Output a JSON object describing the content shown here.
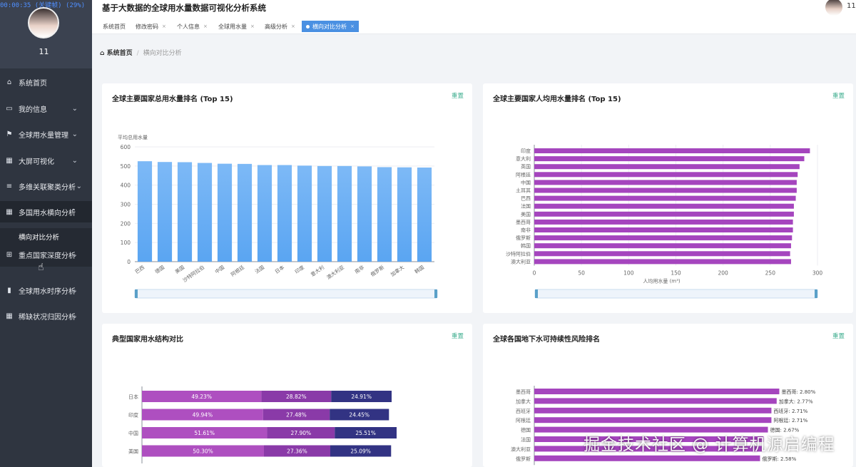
{
  "recording": "00:00:35 (关键帧) (29%)",
  "user": {
    "name": "11"
  },
  "app": {
    "title": "基于大数据的全球用水量数据可视化分析系统"
  },
  "sidebar": {
    "items": [
      {
        "label": "系统首页",
        "icon": "home-icon"
      },
      {
        "label": "我的信息",
        "icon": "card-icon"
      },
      {
        "label": "全球用水量管理",
        "icon": "flag-icon"
      },
      {
        "label": "大屏可视化",
        "icon": "grid-icon"
      },
      {
        "label": "多维关联聚类分析",
        "icon": "list-icon"
      },
      {
        "label": "多国用水横向分析",
        "icon": "grid-icon"
      },
      {
        "label": "重点国家深度分析",
        "icon": "apps-icon"
      },
      {
        "label": "全球用水时序分析",
        "icon": "bar-chart-icon"
      },
      {
        "label": "稀缺状况归因分析",
        "icon": "grid-icon"
      }
    ],
    "subitem": "横向对比分析"
  },
  "tabs": [
    {
      "label": "系统首页"
    },
    {
      "label": "修改密码"
    },
    {
      "label": "个人信息"
    },
    {
      "label": "全球用水量"
    },
    {
      "label": "高级分析"
    },
    {
      "label": "横向对比分析"
    }
  ],
  "breadcrumb": {
    "home": "系统首页",
    "sep": "/",
    "current": "横向对比分析"
  },
  "reset_label": "重置",
  "cards": {
    "c1": {
      "title": "全球主要国家总用水量排名 (Top 15)"
    },
    "c2": {
      "title": "全球主要国家人均用水量排名 (Top 15)"
    },
    "c3": {
      "title": "典型国家用水结构对比"
    },
    "c4": {
      "title": "全球各国地下水可持续性风险排名"
    }
  },
  "chart_data": [
    {
      "type": "bar",
      "title": "全球主要国家总用水量排名 (Top 15)",
      "ylabel": "平均总用水量",
      "categories": [
        "巴西",
        "德国",
        "美国",
        "沙特阿拉伯",
        "中国",
        "阿根廷",
        "法国",
        "日本",
        "印度",
        "意大利",
        "澳大利亚",
        "南非",
        "俄罗斯",
        "加拿大",
        "韩国"
      ],
      "values": [
        525,
        521,
        520,
        516,
        512,
        511,
        505,
        505,
        502,
        500,
        500,
        498,
        494,
        493,
        492
      ],
      "ylim": [
        0,
        600
      ],
      "yticks": [
        "0",
        "100",
        "200",
        "300",
        "400",
        "500",
        "600"
      ],
      "color": "#5aa5f2"
    },
    {
      "type": "bar",
      "orientation": "horizontal",
      "title": "全球主要国家人均用水量排名 (Top 15)",
      "xlabel": "人均用水量 (m³)",
      "categories": [
        "印度",
        "意大利",
        "英国",
        "阿根廷",
        "中国",
        "土耳其",
        "巴西",
        "法国",
        "美国",
        "墨西哥",
        "南非",
        "俄罗斯",
        "韩国",
        "沙特阿拉伯",
        "澳大利亚"
      ],
      "values": [
        292,
        286,
        281,
        279,
        278,
        278,
        277,
        275,
        275,
        274,
        274,
        273,
        272,
        271,
        272
      ],
      "xlim": [
        0,
        300
      ],
      "xticks": [
        "0",
        "50",
        "100",
        "150",
        "200",
        "250",
        "300"
      ],
      "color": "#a545be"
    },
    {
      "type": "bar",
      "orientation": "horizontal",
      "stacked": true,
      "title": "典型国家用水结构对比",
      "categories": [
        "日本",
        "印度",
        "中国",
        "美国"
      ],
      "series": [
        {
          "values": [
            49.23,
            49.94,
            51.61,
            50.3
          ],
          "labels": [
            "49.23%",
            "49.94%",
            "51.61%",
            "50.30%"
          ],
          "color": "#ae4fc0"
        },
        {
          "values": [
            28.82,
            27.48,
            27.9,
            27.36
          ],
          "labels": [
            "28.82%",
            "27.48%",
            "27.90%",
            "27.36%"
          ],
          "color": "#8a3aa8"
        },
        {
          "values": [
            24.91,
            24.45,
            25.51,
            25.09
          ],
          "labels": [
            "24.91%",
            "24.45%",
            "25.51%",
            "25.09%"
          ],
          "color": "#323383"
        }
      ]
    },
    {
      "type": "bar",
      "orientation": "horizontal",
      "title": "全球各国地下水可持续性风险排名",
      "categories": [
        "墨西哥",
        "加拿大",
        "西班牙",
        "阿根廷",
        "德国",
        "法国",
        "澳大利亚",
        "俄罗斯"
      ],
      "values": [
        2.8,
        2.77,
        2.71,
        2.71,
        2.67,
        2.62,
        2.6,
        2.58
      ],
      "labels": [
        "墨西哥: 2.80%",
        "加拿大: 2.77%",
        "西班牙: 2.71%",
        "阿根廷: 2.71%",
        "德国: 2.67%",
        "",
        "",
        "俄罗斯: 2.58%"
      ],
      "color": "#a545be"
    }
  ],
  "watermark": "掘金技术社区 @ 计算机源启编程"
}
